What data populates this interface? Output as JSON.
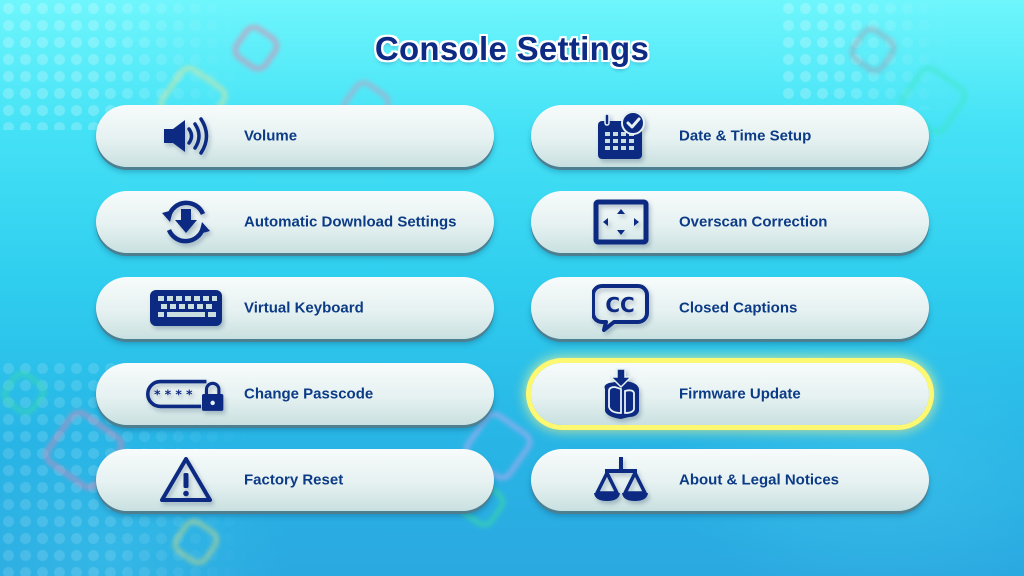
{
  "screen": {
    "title": "Console Settings"
  },
  "theme": {
    "accent": "#0c3b86",
    "title_color": "#0d2a84",
    "selection_color": "#fdf872",
    "button_face": "#eef6f6"
  },
  "menu": {
    "selected_index": 7,
    "items": [
      {
        "label": "Volume",
        "icon": "speaker-volume-icon"
      },
      {
        "label": "Date & Time Setup",
        "icon": "calendar-clock-icon"
      },
      {
        "label": "Automatic Download Settings",
        "icon": "auto-download-sync-icon"
      },
      {
        "label": "Overscan Correction",
        "icon": "overscan-frame-icon"
      },
      {
        "label": "Virtual Keyboard",
        "icon": "keyboard-icon"
      },
      {
        "label": "Closed Captions",
        "icon": "closed-captions-icon"
      },
      {
        "label": "Change Passcode",
        "icon": "passcode-lock-icon"
      },
      {
        "label": "Firmware Update",
        "icon": "firmware-update-icon"
      },
      {
        "label": "Factory Reset",
        "icon": "warning-triangle-icon"
      },
      {
        "label": "About & Legal Notices",
        "icon": "legal-scales-icon"
      }
    ]
  }
}
